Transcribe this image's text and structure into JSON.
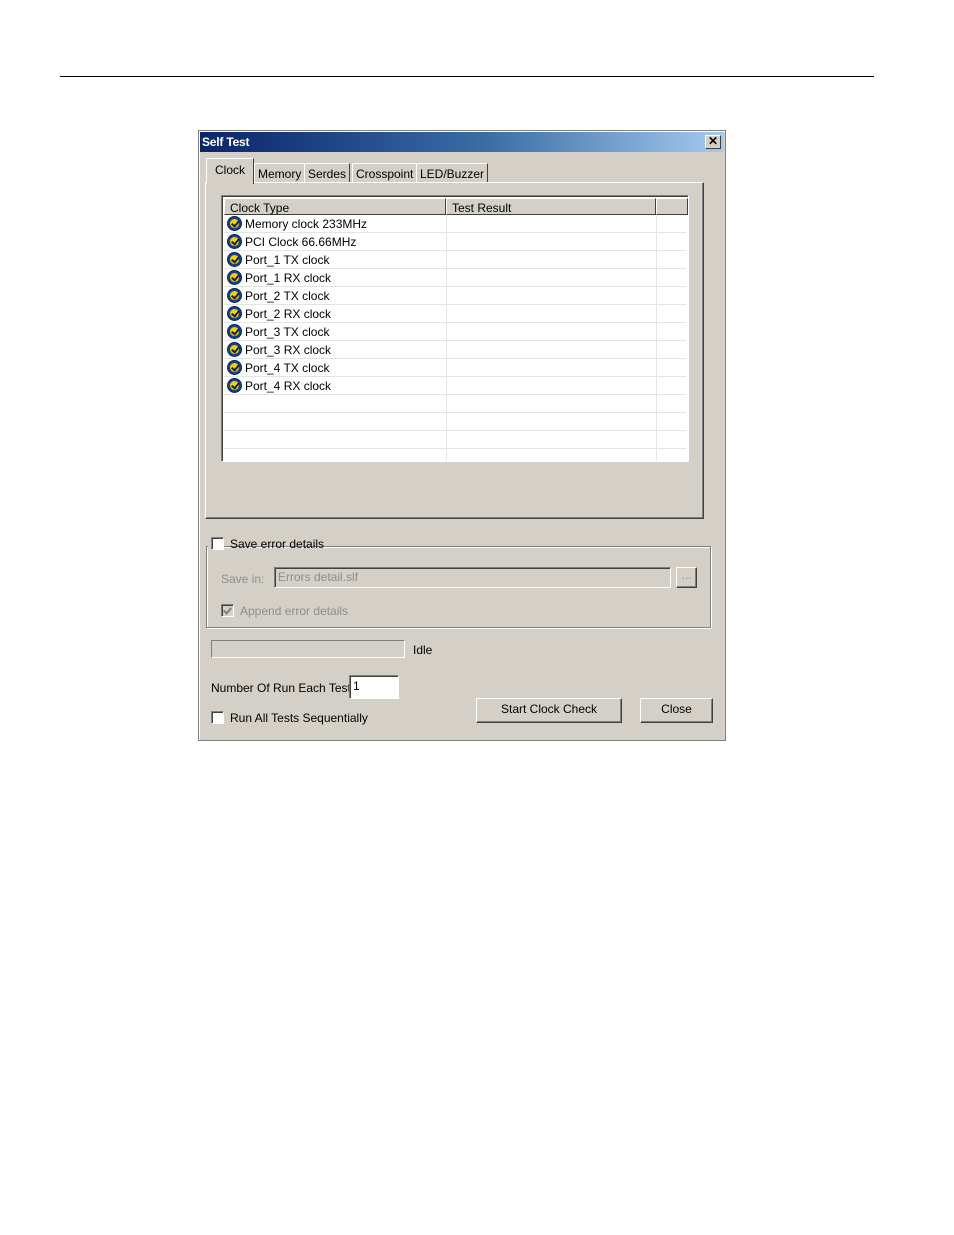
{
  "window": {
    "title": "Self Test",
    "close_glyph": "✕"
  },
  "tabs": [
    {
      "label": "Clock",
      "active": true
    },
    {
      "label": "Memory"
    },
    {
      "label": "Serdes"
    },
    {
      "label": "Crosspoint"
    },
    {
      "label": "LED/Buzzer"
    }
  ],
  "clock_list": {
    "columns": [
      "Clock Type",
      "Test Result"
    ],
    "rows": [
      {
        "icon": "check-badge-icon",
        "clock_type": "Memory clock 233MHz",
        "result": ""
      },
      {
        "icon": "check-badge-icon",
        "clock_type": "PCI Clock 66.66MHz",
        "result": ""
      },
      {
        "icon": "check-badge-icon",
        "clock_type": "Port_1 TX clock",
        "result": ""
      },
      {
        "icon": "check-badge-icon",
        "clock_type": "Port_1 RX clock",
        "result": ""
      },
      {
        "icon": "check-badge-icon",
        "clock_type": "Port_2 TX clock",
        "result": ""
      },
      {
        "icon": "check-badge-icon",
        "clock_type": "Port_2 RX clock",
        "result": ""
      },
      {
        "icon": "check-badge-icon",
        "clock_type": "Port_3 TX clock",
        "result": ""
      },
      {
        "icon": "check-badge-icon",
        "clock_type": "Port_3 RX clock",
        "result": ""
      },
      {
        "icon": "check-badge-icon",
        "clock_type": "Port_4 TX clock",
        "result": ""
      },
      {
        "icon": "check-badge-icon",
        "clock_type": "Port_4 RX clock",
        "result": ""
      }
    ]
  },
  "save_errors": {
    "checkbox_label": "Save error details",
    "checked": false,
    "save_in_label": "Save in:",
    "save_in_value": "Errors detail.slf",
    "browse_label": "...",
    "append_label": "Append error details",
    "append_checked": true
  },
  "status": {
    "progress_fraction": 0,
    "text": "Idle"
  },
  "run": {
    "count_label": "Number Of Run Each Test:",
    "count_value": "1",
    "sequential_label": "Run All Tests Sequentially",
    "sequential_checked": false
  },
  "buttons": {
    "start": "Start Clock Check",
    "close": "Close"
  },
  "colors": {
    "face": "#d4d0c8",
    "title_start": "#0a246a",
    "title_end": "#a6caf0",
    "icon_fill": "#f2d200",
    "icon_ring": "#1b3f8c"
  }
}
